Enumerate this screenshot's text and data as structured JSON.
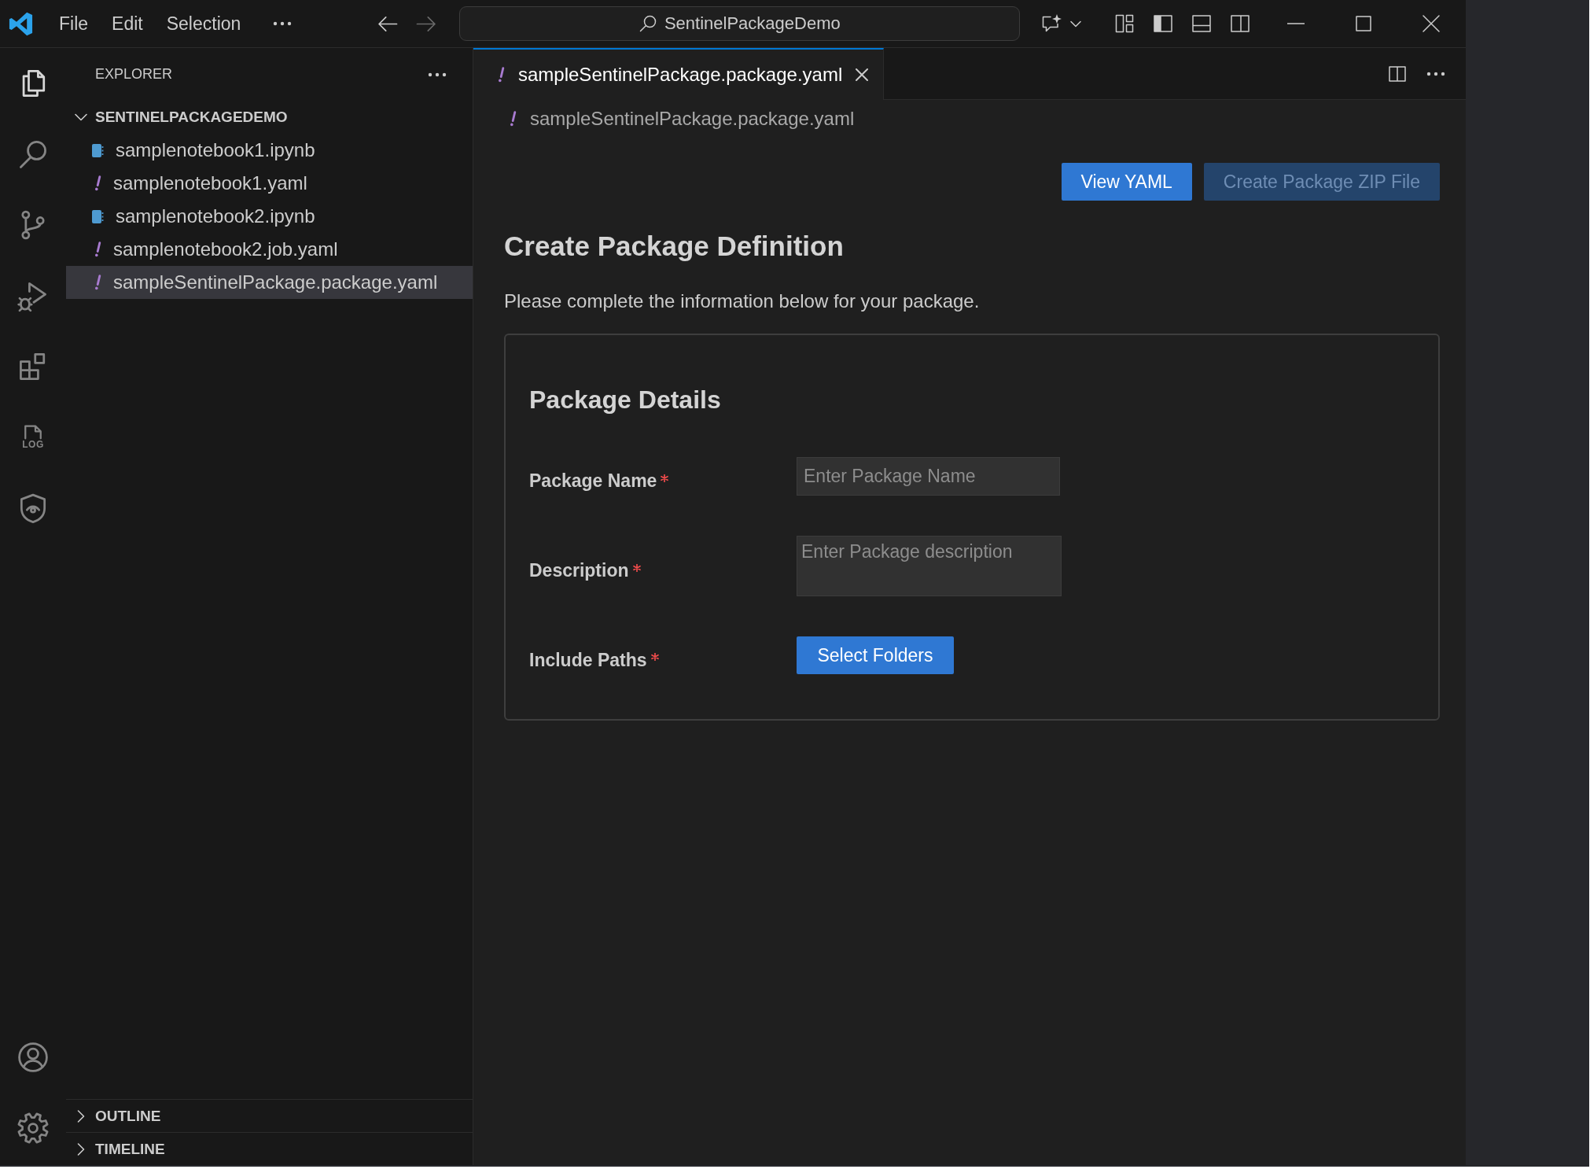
{
  "title_bar": {
    "menu": [
      {
        "label": "File"
      },
      {
        "label": "Edit"
      },
      {
        "label": "Selection"
      }
    ],
    "navigation": {
      "back": {
        "disabled": false
      },
      "forward": {
        "disabled": true
      }
    },
    "command_center": "SentinelPackageDemo",
    "layout": {
      "primary_sidebar": {
        "on": true
      },
      "panel": {
        "on": false
      },
      "secondary_sidebar": {
        "on": false
      }
    }
  },
  "activity_bar": {
    "items": [
      {
        "selected": true
      },
      {
        "selected": false
      },
      {
        "selected": false
      },
      {
        "selected": false
      },
      {
        "selected": false
      },
      {
        "label": "LOG",
        "selected": false
      },
      {
        "selected": false
      }
    ]
  },
  "explorer": {
    "title": "EXPLORER",
    "folder": {
      "label": "SENTINELPACKAGEDEMO",
      "expanded": true,
      "children": [
        {
          "label": "samplenotebook1.ipynb",
          "kind": "notebook",
          "selected": false
        },
        {
          "label": "samplenotebook1.yaml",
          "kind": "yaml",
          "selected": false
        },
        {
          "label": "samplenotebook2.ipynb",
          "kind": "notebook",
          "selected": false
        },
        {
          "label": "samplenotebook2.job.yaml",
          "kind": "yaml",
          "selected": false
        },
        {
          "label": "sampleSentinelPackage.package.yaml",
          "kind": "yaml",
          "selected": true
        }
      ]
    },
    "sections": [
      {
        "label": "OUTLINE",
        "expanded": false
      },
      {
        "label": "TIMELINE",
        "expanded": false
      }
    ]
  },
  "editor": {
    "tabs": [
      {
        "label": "sampleSentinelPackage.package.yaml",
        "kind": "yaml",
        "selected": true
      }
    ],
    "breadcrumb": [
      {
        "label": "sampleSentinelPackage.package.yaml",
        "kind": "yaml"
      }
    ],
    "actions": [
      {
        "label": "View YAML",
        "disabled": false
      },
      {
        "label": "Create Package ZIP File",
        "disabled": true
      }
    ],
    "heading": "Create Package Definition",
    "intro": "Please complete the information below for your package.",
    "card": {
      "title": "Package Details",
      "fields": [
        {
          "label": "Package Name",
          "required": true,
          "kind": "text",
          "placeholder": "Enter Package Name"
        },
        {
          "label": "Description",
          "required": true,
          "kind": "textarea",
          "placeholder": "Enter Package description"
        },
        {
          "label": "Include Paths",
          "required": true,
          "kind": "folders",
          "button": "Select Folders"
        }
      ]
    }
  }
}
